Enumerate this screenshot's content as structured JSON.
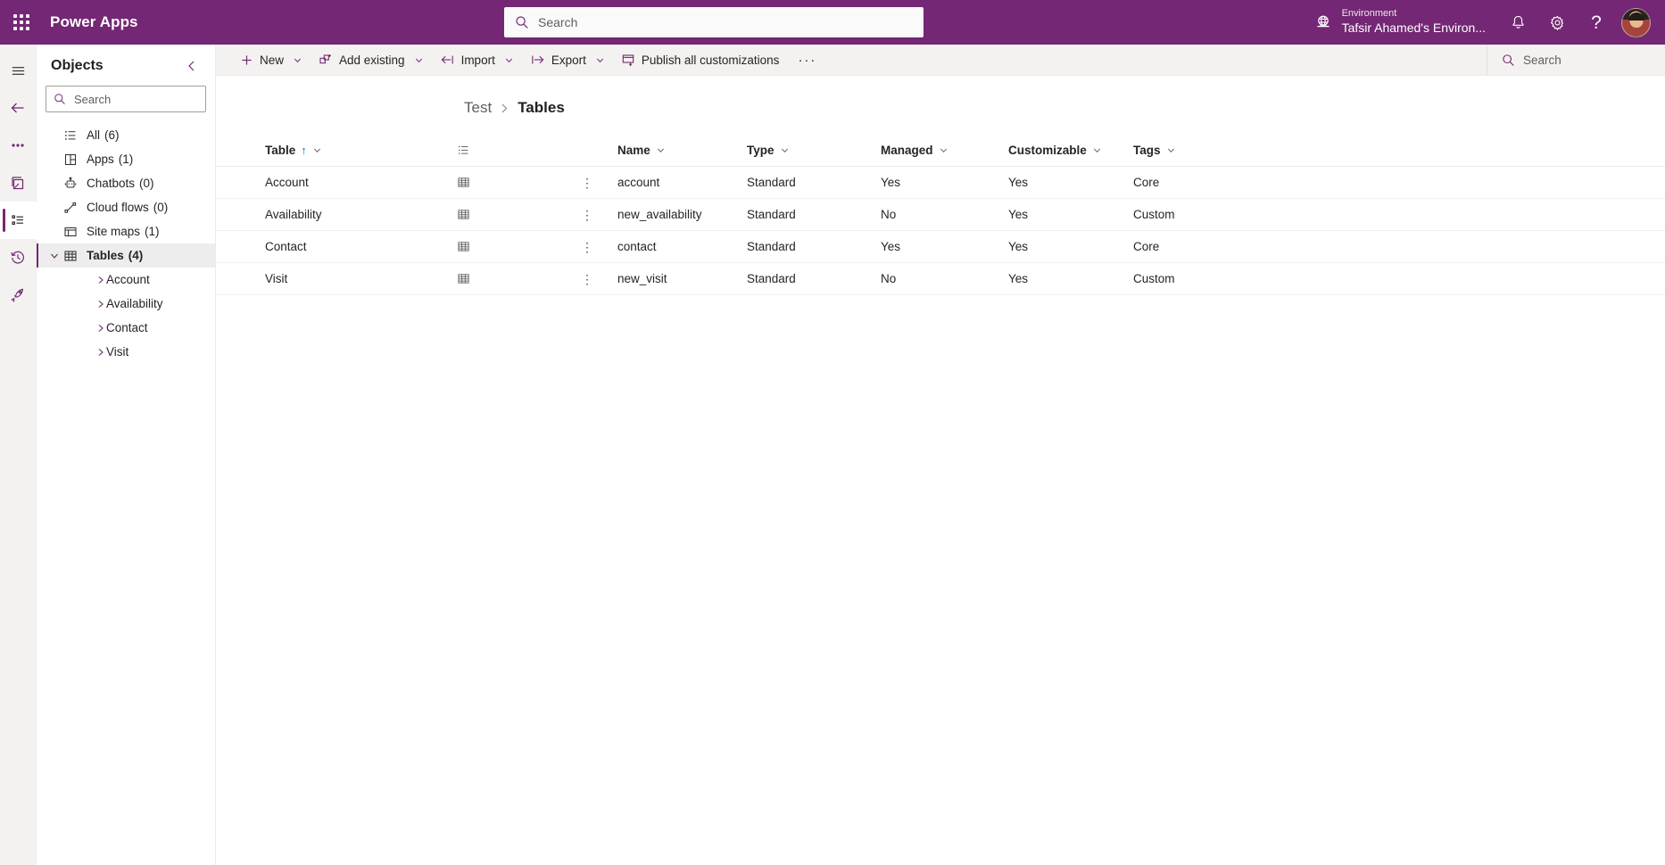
{
  "header": {
    "waffle_title": "App launcher",
    "brand": "Power Apps",
    "search": {
      "placeholder": "Search",
      "value": ""
    },
    "environment": {
      "label": "Environment",
      "name": "Tafsir Ahamed's Environ..."
    },
    "notifications_title": "Notifications",
    "settings_title": "Settings",
    "help_title": "Help",
    "avatar_title": "Account manager"
  },
  "rail": {
    "items": [
      {
        "name": "menu",
        "title": "Expand navigation"
      },
      {
        "name": "back",
        "title": "Back"
      },
      {
        "name": "more",
        "title": "More"
      },
      {
        "name": "pages",
        "title": "Pages"
      },
      {
        "name": "objects",
        "title": "Objects",
        "selected": true
      },
      {
        "name": "history",
        "title": "Recent"
      },
      {
        "name": "learn",
        "title": "Get started"
      }
    ]
  },
  "objects_panel": {
    "title": "Objects",
    "collapse_title": "Collapse",
    "search": {
      "placeholder": "Search",
      "value": ""
    },
    "items": [
      {
        "label": "All",
        "count": "(6)",
        "icon": "list-icon",
        "expandable": false
      },
      {
        "label": "Apps",
        "count": "(1)",
        "icon": "apps-icon",
        "expandable": false
      },
      {
        "label": "Chatbots",
        "count": "(0)",
        "icon": "chatbot-icon",
        "expandable": false
      },
      {
        "label": "Cloud flows",
        "count": "(0)",
        "icon": "flow-icon",
        "expandable": false
      },
      {
        "label": "Site maps",
        "count": "(1)",
        "icon": "sitemap-icon",
        "expandable": false
      },
      {
        "label": "Tables",
        "count": "(4)",
        "icon": "table-icon",
        "expandable": true,
        "expanded": true,
        "active": true
      }
    ],
    "tables_children": [
      {
        "label": "Account"
      },
      {
        "label": "Availability"
      },
      {
        "label": "Contact"
      },
      {
        "label": "Visit"
      }
    ]
  },
  "commandbar": {
    "items": [
      {
        "label": "New",
        "icon": "plus-icon",
        "caret": true
      },
      {
        "label": "Add existing",
        "icon": "add-existing-icon",
        "caret": true
      },
      {
        "label": "Import",
        "icon": "import-icon",
        "caret": true
      },
      {
        "label": "Export",
        "icon": "export-icon",
        "caret": true
      },
      {
        "label": "Publish all customizations",
        "icon": "publish-icon",
        "caret": false
      }
    ],
    "overflow": "···",
    "search": {
      "placeholder": "Search",
      "value": ""
    }
  },
  "breadcrumb": {
    "parent": "Test",
    "separator": "›",
    "current": "Tables"
  },
  "table": {
    "columns": [
      {
        "key": "picker",
        "label": "",
        "icon": "column-options-icon"
      },
      {
        "key": "table",
        "label": "Table",
        "sorted": "↑",
        "caret": true
      },
      {
        "key": "name",
        "label": "Name",
        "caret": true
      },
      {
        "key": "type",
        "label": "Type",
        "caret": true
      },
      {
        "key": "managed",
        "label": "Managed",
        "caret": true
      },
      {
        "key": "customizable",
        "label": "Customizable",
        "caret": true
      },
      {
        "key": "tags",
        "label": "Tags",
        "caret": true
      }
    ],
    "rows": [
      {
        "table": "Account",
        "name": "account",
        "type": "Standard",
        "managed": "Yes",
        "customizable": "Yes",
        "tags": "Core"
      },
      {
        "table": "Availability",
        "name": "new_availability",
        "type": "Standard",
        "managed": "No",
        "customizable": "Yes",
        "tags": "Custom"
      },
      {
        "table": "Contact",
        "name": "contact",
        "type": "Standard",
        "managed": "Yes",
        "customizable": "Yes",
        "tags": "Core"
      },
      {
        "table": "Visit",
        "name": "new_visit",
        "type": "Standard",
        "managed": "No",
        "customizable": "Yes",
        "tags": "Custom"
      }
    ],
    "row_more_label": "⋮"
  },
  "colors": {
    "brand_purple": "#742774",
    "rail_bg": "#f3f2f1",
    "text": "#242424",
    "muted": "#605e5c"
  }
}
